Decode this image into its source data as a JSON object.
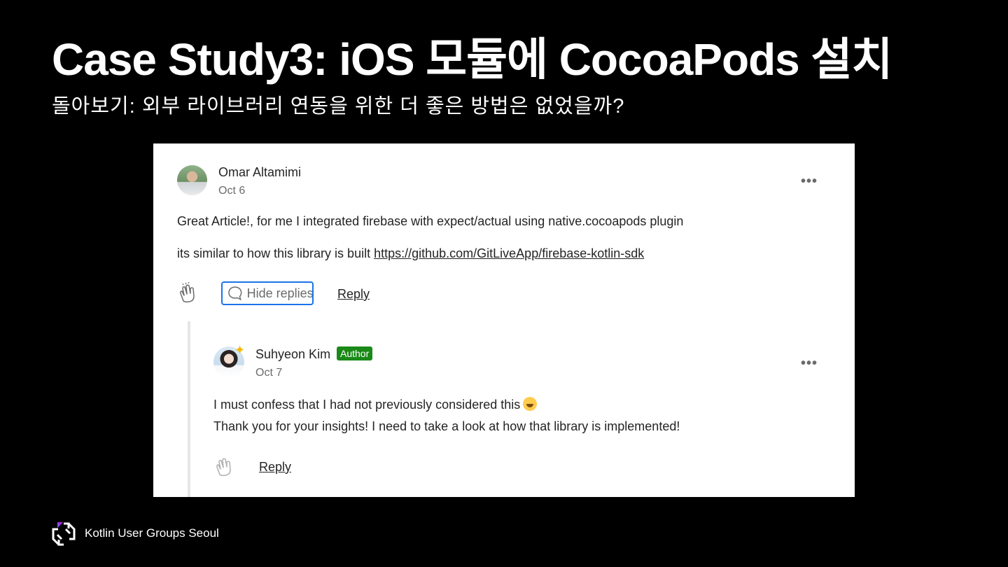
{
  "slide": {
    "title": "Case Study3: iOS 모듈에 CocoaPods 설치",
    "subtitle": "돌아보기: 외부 라이브러리 연동을 위한 더 좋은 방법은 없었을까?"
  },
  "comment": {
    "author": "Omar Altamimi",
    "date": "Oct 6",
    "line1": "Great Article!, for me I integrated firebase with expect/actual using native.cocoapods plugin",
    "line2_prefix": "its similar to how this library is built ",
    "line2_link": "https://github.com/GitLiveApp/firebase-kotlin-sdk",
    "hide_replies_label": "Hide replies",
    "reply_label": "Reply",
    "more_label": "•••"
  },
  "reply": {
    "author": "Suhyeon Kim",
    "badge": "Author",
    "date": "Oct 7",
    "line1": "I must confess that I had not previously considered this",
    "line2": "Thank you for your insights! I need to take a look at how that library is implemented!",
    "reply_label": "Reply",
    "more_label": "•••"
  },
  "footer": {
    "org": "Kotlin User Groups Seoul"
  },
  "icons": {
    "clap": "clap-icon",
    "comment": "speech-bubble-icon",
    "more": "more-horizontal-icon",
    "emoji": "laughing-emoji-icon",
    "logo": "kotlin-user-groups-logo-icon"
  },
  "colors": {
    "slide_bg": "#000000",
    "panel_bg": "#ffffff",
    "focus_ring": "#1a73e8",
    "author_badge": "#1a8917"
  }
}
